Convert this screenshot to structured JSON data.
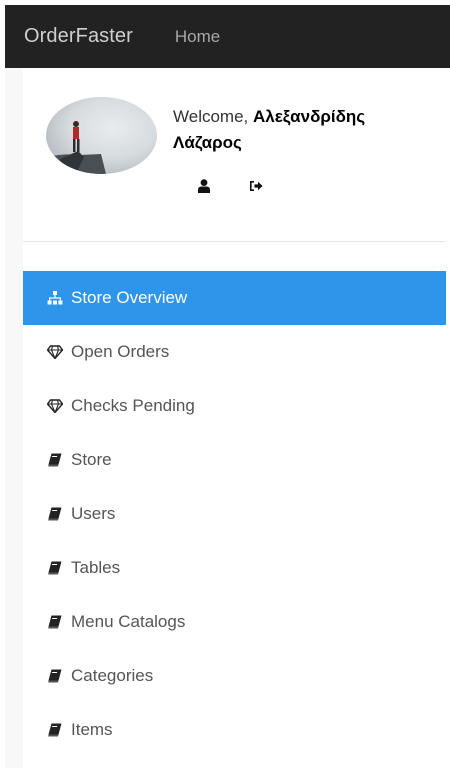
{
  "navbar": {
    "brand": "OrderFaster",
    "home_label": "Home"
  },
  "profile": {
    "welcome_prefix": "Welcome, ",
    "user_name": "Αλεξανδρίδης Λάζαρος",
    "icons": [
      "user-icon",
      "sign-out-icon"
    ]
  },
  "menu": {
    "items": [
      {
        "label": "Store Overview",
        "icon": "sitemap-icon",
        "active": true
      },
      {
        "label": "Open Orders",
        "icon": "diamond-icon",
        "active": false
      },
      {
        "label": "Checks Pending",
        "icon": "diamond-icon",
        "active": false
      },
      {
        "label": "Store",
        "icon": "book-icon",
        "active": false
      },
      {
        "label": "Users",
        "icon": "book-icon",
        "active": false
      },
      {
        "label": "Tables",
        "icon": "book-icon",
        "active": false
      },
      {
        "label": "Menu Catalogs",
        "icon": "book-icon",
        "active": false
      },
      {
        "label": "Categories",
        "icon": "book-icon",
        "active": false
      },
      {
        "label": "Items",
        "icon": "book-icon",
        "active": false
      }
    ]
  },
  "colors": {
    "navbar_bg": "#222222",
    "active_item_bg": "#2f95ea",
    "sidebar_bg": "#f8f8f8"
  }
}
